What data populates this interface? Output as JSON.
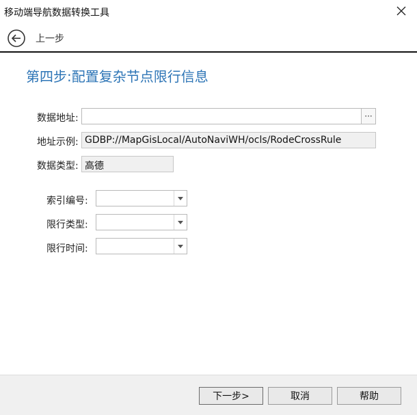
{
  "window": {
    "title": "移动端导航数据转换工具",
    "close_icon": "close-icon"
  },
  "nav": {
    "back_label": "上一步",
    "back_icon": "circle-arrow-left-icon"
  },
  "step": {
    "title": "第四步:配置复杂节点限行信息"
  },
  "form": {
    "data_address": {
      "label": "数据地址:",
      "value": "",
      "browse_label": "···"
    },
    "address_example": {
      "label": "地址示例:",
      "value": "GDBP://MapGisLocal/AutoNaviWH/ocls/RodeCrossRule"
    },
    "data_type": {
      "label": "数据类型:",
      "value": "高德"
    },
    "index_number": {
      "label": "索引编号:",
      "value": ""
    },
    "restriction_type": {
      "label": "限行类型:",
      "value": ""
    },
    "restriction_time": {
      "label": "限行时间:",
      "value": ""
    }
  },
  "footer": {
    "next_label": "下一步>",
    "cancel_label": "取消",
    "help_label": "帮助"
  },
  "colors": {
    "accent": "#2e75b6",
    "footer_bg": "#f0f0f0"
  }
}
